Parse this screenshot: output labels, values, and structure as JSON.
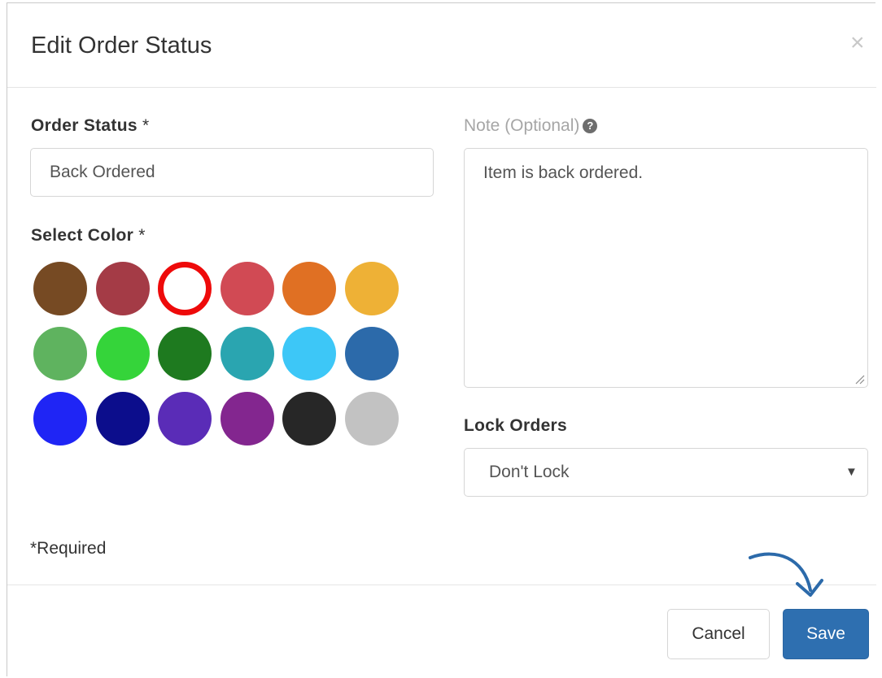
{
  "dialog": {
    "title": "Edit Order Status",
    "close_glyph": "×"
  },
  "order_status": {
    "label": "Order Status",
    "required_mark": " *",
    "value": "Back Ordered"
  },
  "color_picker": {
    "label": "Select Color",
    "required_mark": " *",
    "selected_index": 2,
    "colors": [
      "#764a23",
      "#a43b46",
      "#ee0a0a",
      "#d14a54",
      "#e07023",
      "#eeb136",
      "#5fb35f",
      "#35d43a",
      "#1e7a1f",
      "#2aa5b0",
      "#3dc7f7",
      "#2c6aaa",
      "#1f25f5",
      "#0c0d8c",
      "#5a2cb7",
      "#83268f",
      "#272727",
      "#c2c2c2"
    ]
  },
  "note": {
    "label": "Note (Optional)",
    "help_glyph": "?",
    "value": "Item is back ordered."
  },
  "lock_orders": {
    "label": "Lock Orders",
    "selected": "Don't Lock",
    "caret": "▼"
  },
  "required_note": "*Required",
  "footer": {
    "cancel_label": "Cancel",
    "save_label": "Save"
  },
  "annotation_color": "#2c6aaa"
}
